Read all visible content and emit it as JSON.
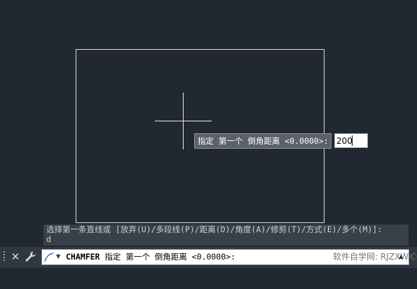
{
  "prompt": {
    "label": "指定 第一个 倒角距离 <0.0000>:",
    "input_value": "200"
  },
  "history": {
    "line1": "选择第一条直线或 [放弃(U)/多段线(P)/距离(D)/角度(A)/修剪(T)/方式(E)/多个(M)]:",
    "line2": "d"
  },
  "command_line": {
    "command": "CHAMFER",
    "text": "指定 第一个 倒角距离 <0.0000>:",
    "watermark": "软件自学网: RJZXW.COM"
  },
  "icons": {
    "close": "close-icon",
    "wrench": "wrench-icon",
    "command": "command-curve-icon",
    "arrow": "chevron-down-icon"
  },
  "colors": {
    "background": "#212831",
    "lines": "#d9dce0",
    "prompt_bg": "#5b6169"
  }
}
